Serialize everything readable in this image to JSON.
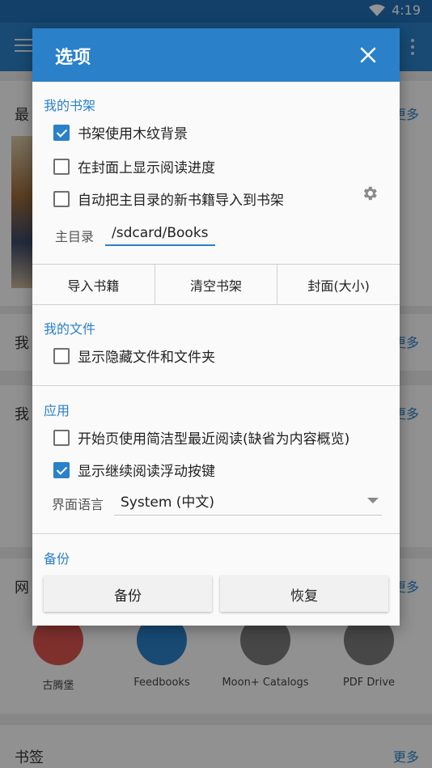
{
  "status_bar": {
    "time": "4:19",
    "wifi_icon": "wifi-icon",
    "battery_icon": "battery-icon"
  },
  "background": {
    "sections": [
      {
        "title": "最",
        "more": "更多"
      },
      {
        "title": "我",
        "more": "更多"
      },
      {
        "title": "我",
        "more": "更多"
      },
      {
        "title": "网",
        "more": "更多"
      },
      {
        "title": "书签",
        "more": "更多"
      }
    ],
    "catalogs": [
      {
        "label": "古腾堡",
        "color": "#d9534f"
      },
      {
        "label": "Feedbooks",
        "color": "#2a80c9"
      },
      {
        "label": "Moon+ Catalogs",
        "color": "#7a7a7a"
      },
      {
        "label": "PDF Drive",
        "color": "#7a7a7a"
      }
    ]
  },
  "dialog": {
    "title": "选项",
    "bookshelf": {
      "section_label": "我的书架",
      "options": [
        {
          "label": "书架使用木纹背景",
          "checked": true
        },
        {
          "label": "在封面上显示阅读进度",
          "checked": false
        },
        {
          "label": "自动把主目录的新书籍导入到书架",
          "checked": false
        }
      ],
      "home_dir_label": "主目录",
      "home_dir_value": "/sdcard/Books",
      "buttons": [
        "导入书籍",
        "清空书架",
        "封面(大小)"
      ]
    },
    "files": {
      "section_label": "我的文件",
      "options": [
        {
          "label": "显示隐藏文件和文件夹",
          "checked": false
        }
      ]
    },
    "app": {
      "section_label": "应用",
      "options": [
        {
          "label": "开始页使用简洁型最近阅读(缺省为内容概览)",
          "checked": false
        },
        {
          "label": "显示继续阅读浮动按键",
          "checked": true
        }
      ],
      "language_label": "界面语言",
      "language_value": "System (中文)"
    },
    "backup": {
      "section_label": "备份",
      "backup_button": "备份",
      "restore_button": "恢复"
    }
  },
  "colors": {
    "accent": "#2a80c9",
    "status_bar": "#1f6fb4"
  }
}
